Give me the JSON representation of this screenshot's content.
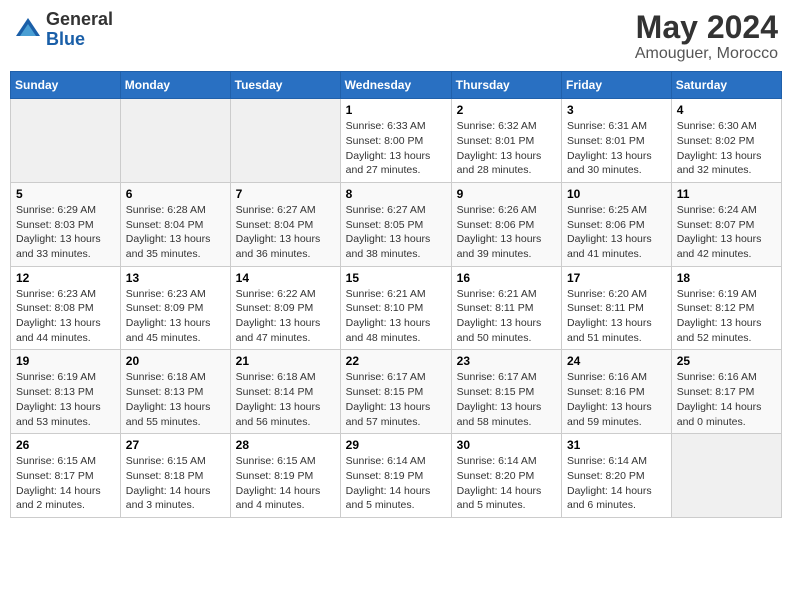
{
  "header": {
    "logo_general": "General",
    "logo_blue": "Blue",
    "month_title": "May 2024",
    "location": "Amouguer, Morocco"
  },
  "days_of_week": [
    "Sunday",
    "Monday",
    "Tuesday",
    "Wednesday",
    "Thursday",
    "Friday",
    "Saturday"
  ],
  "weeks": [
    {
      "cells": [
        {
          "day": "",
          "empty": true
        },
        {
          "day": "",
          "empty": true
        },
        {
          "day": "",
          "empty": true
        },
        {
          "day": "1",
          "sunrise": "Sunrise: 6:33 AM",
          "sunset": "Sunset: 8:00 PM",
          "daylight": "Daylight: 13 hours and 27 minutes."
        },
        {
          "day": "2",
          "sunrise": "Sunrise: 6:32 AM",
          "sunset": "Sunset: 8:01 PM",
          "daylight": "Daylight: 13 hours and 28 minutes."
        },
        {
          "day": "3",
          "sunrise": "Sunrise: 6:31 AM",
          "sunset": "Sunset: 8:01 PM",
          "daylight": "Daylight: 13 hours and 30 minutes."
        },
        {
          "day": "4",
          "sunrise": "Sunrise: 6:30 AM",
          "sunset": "Sunset: 8:02 PM",
          "daylight": "Daylight: 13 hours and 32 minutes."
        }
      ]
    },
    {
      "cells": [
        {
          "day": "5",
          "sunrise": "Sunrise: 6:29 AM",
          "sunset": "Sunset: 8:03 PM",
          "daylight": "Daylight: 13 hours and 33 minutes."
        },
        {
          "day": "6",
          "sunrise": "Sunrise: 6:28 AM",
          "sunset": "Sunset: 8:04 PM",
          "daylight": "Daylight: 13 hours and 35 minutes."
        },
        {
          "day": "7",
          "sunrise": "Sunrise: 6:27 AM",
          "sunset": "Sunset: 8:04 PM",
          "daylight": "Daylight: 13 hours and 36 minutes."
        },
        {
          "day": "8",
          "sunrise": "Sunrise: 6:27 AM",
          "sunset": "Sunset: 8:05 PM",
          "daylight": "Daylight: 13 hours and 38 minutes."
        },
        {
          "day": "9",
          "sunrise": "Sunrise: 6:26 AM",
          "sunset": "Sunset: 8:06 PM",
          "daylight": "Daylight: 13 hours and 39 minutes."
        },
        {
          "day": "10",
          "sunrise": "Sunrise: 6:25 AM",
          "sunset": "Sunset: 8:06 PM",
          "daylight": "Daylight: 13 hours and 41 minutes."
        },
        {
          "day": "11",
          "sunrise": "Sunrise: 6:24 AM",
          "sunset": "Sunset: 8:07 PM",
          "daylight": "Daylight: 13 hours and 42 minutes."
        }
      ]
    },
    {
      "cells": [
        {
          "day": "12",
          "sunrise": "Sunrise: 6:23 AM",
          "sunset": "Sunset: 8:08 PM",
          "daylight": "Daylight: 13 hours and 44 minutes."
        },
        {
          "day": "13",
          "sunrise": "Sunrise: 6:23 AM",
          "sunset": "Sunset: 8:09 PM",
          "daylight": "Daylight: 13 hours and 45 minutes."
        },
        {
          "day": "14",
          "sunrise": "Sunrise: 6:22 AM",
          "sunset": "Sunset: 8:09 PM",
          "daylight": "Daylight: 13 hours and 47 minutes."
        },
        {
          "day": "15",
          "sunrise": "Sunrise: 6:21 AM",
          "sunset": "Sunset: 8:10 PM",
          "daylight": "Daylight: 13 hours and 48 minutes."
        },
        {
          "day": "16",
          "sunrise": "Sunrise: 6:21 AM",
          "sunset": "Sunset: 8:11 PM",
          "daylight": "Daylight: 13 hours and 50 minutes."
        },
        {
          "day": "17",
          "sunrise": "Sunrise: 6:20 AM",
          "sunset": "Sunset: 8:11 PM",
          "daylight": "Daylight: 13 hours and 51 minutes."
        },
        {
          "day": "18",
          "sunrise": "Sunrise: 6:19 AM",
          "sunset": "Sunset: 8:12 PM",
          "daylight": "Daylight: 13 hours and 52 minutes."
        }
      ]
    },
    {
      "cells": [
        {
          "day": "19",
          "sunrise": "Sunrise: 6:19 AM",
          "sunset": "Sunset: 8:13 PM",
          "daylight": "Daylight: 13 hours and 53 minutes."
        },
        {
          "day": "20",
          "sunrise": "Sunrise: 6:18 AM",
          "sunset": "Sunset: 8:13 PM",
          "daylight": "Daylight: 13 hours and 55 minutes."
        },
        {
          "day": "21",
          "sunrise": "Sunrise: 6:18 AM",
          "sunset": "Sunset: 8:14 PM",
          "daylight": "Daylight: 13 hours and 56 minutes."
        },
        {
          "day": "22",
          "sunrise": "Sunrise: 6:17 AM",
          "sunset": "Sunset: 8:15 PM",
          "daylight": "Daylight: 13 hours and 57 minutes."
        },
        {
          "day": "23",
          "sunrise": "Sunrise: 6:17 AM",
          "sunset": "Sunset: 8:15 PM",
          "daylight": "Daylight: 13 hours and 58 minutes."
        },
        {
          "day": "24",
          "sunrise": "Sunrise: 6:16 AM",
          "sunset": "Sunset: 8:16 PM",
          "daylight": "Daylight: 13 hours and 59 minutes."
        },
        {
          "day": "25",
          "sunrise": "Sunrise: 6:16 AM",
          "sunset": "Sunset: 8:17 PM",
          "daylight": "Daylight: 14 hours and 0 minutes."
        }
      ]
    },
    {
      "cells": [
        {
          "day": "26",
          "sunrise": "Sunrise: 6:15 AM",
          "sunset": "Sunset: 8:17 PM",
          "daylight": "Daylight: 14 hours and 2 minutes."
        },
        {
          "day": "27",
          "sunrise": "Sunrise: 6:15 AM",
          "sunset": "Sunset: 8:18 PM",
          "daylight": "Daylight: 14 hours and 3 minutes."
        },
        {
          "day": "28",
          "sunrise": "Sunrise: 6:15 AM",
          "sunset": "Sunset: 8:19 PM",
          "daylight": "Daylight: 14 hours and 4 minutes."
        },
        {
          "day": "29",
          "sunrise": "Sunrise: 6:14 AM",
          "sunset": "Sunset: 8:19 PM",
          "daylight": "Daylight: 14 hours and 5 minutes."
        },
        {
          "day": "30",
          "sunrise": "Sunrise: 6:14 AM",
          "sunset": "Sunset: 8:20 PM",
          "daylight": "Daylight: 14 hours and 5 minutes."
        },
        {
          "day": "31",
          "sunrise": "Sunrise: 6:14 AM",
          "sunset": "Sunset: 8:20 PM",
          "daylight": "Daylight: 14 hours and 6 minutes."
        },
        {
          "day": "",
          "empty": true
        }
      ]
    }
  ]
}
